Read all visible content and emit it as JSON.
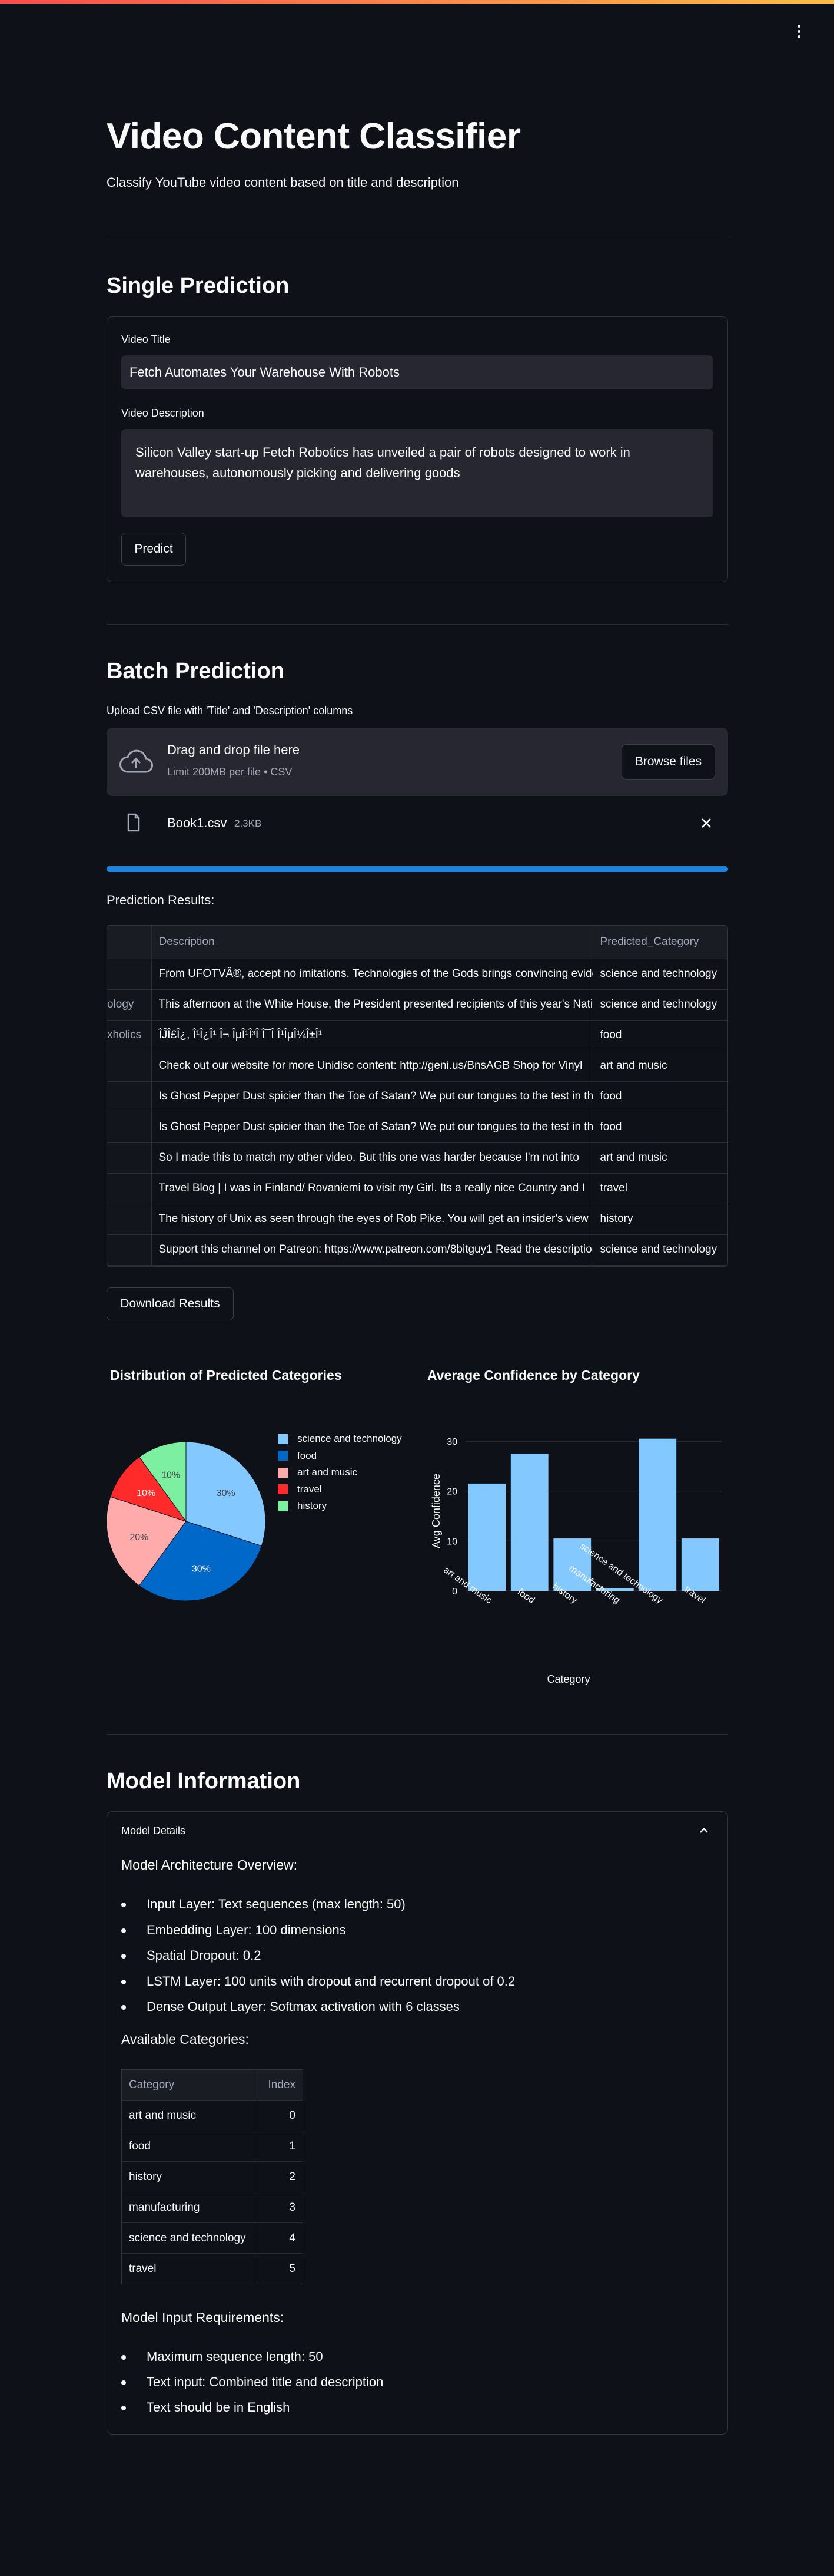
{
  "app": {
    "title": "Video Content Classifier",
    "subtitle": "Classify YouTube video content based on title and description"
  },
  "single": {
    "heading": "Single Prediction",
    "title_label": "Video Title",
    "title_value": "Fetch Automates Your Warehouse With Robots",
    "desc_label": "Video Description",
    "desc_value": "Silicon Valley start-up Fetch Robotics has unveiled a pair of robots designed to work in warehouses, autonomously picking and delivering goods",
    "predict_label": "Predict"
  },
  "batch": {
    "heading": "Batch Prediction",
    "upload_label": "Upload CSV file with 'Title' and 'Description' columns",
    "drop_title": "Drag and drop file here",
    "drop_limit": "Limit 200MB per file • CSV",
    "browse_label": "Browse files",
    "file_name": "Book1.csv",
    "file_size": "2.3KB",
    "progress": 1.0,
    "results_label": "Prediction Results:",
    "columns": [
      "Description",
      "Predicted_Category"
    ],
    "rows": [
      {
        "left": "",
        "description": "From UFOTVÂ®, accept no imitations. Technologies of the Gods brings convincing evidence",
        "category": "science and technology"
      },
      {
        "left": "ology",
        "description": "This afternoon at the White House, the President presented recipients of this year's National Medal",
        "category": "science and technology"
      },
      {
        "left": "xholics",
        "description": "ÎĴÎ£Î¿, Î¹Î¿Î¹ Î¬ ÎµÎ¹Î³Î Î¯Î Î¹ÎµÎ¼Î±Î¹",
        "category": "food"
      },
      {
        "left": "",
        "description": "Check out our website for more Unidisc content: http://geni.us/BnsAGB Shop for Vinyl",
        "category": "art and music"
      },
      {
        "left": "",
        "description": "Is Ghost Pepper Dust spicier than the Toe of Satan? We put our tongues to the test in this",
        "category": "food"
      },
      {
        "left": "",
        "description": "Is Ghost Pepper Dust spicier than the Toe of Satan? We put our tongues to the test in this",
        "category": "food"
      },
      {
        "left": "",
        "description": "So I made this to match my other video. But this one was harder because I'm not into",
        "category": "art and music"
      },
      {
        "left": "",
        "description": "Travel Blog | I was in Finland/ Rovaniemi to visit my Girl. Its a really nice Country and I",
        "category": "travel"
      },
      {
        "left": "",
        "description": "The history of Unix as seen through the eyes of Rob Pike. You will get an insider's view",
        "category": "history"
      },
      {
        "left": "",
        "description": "Support this channel on Patreon: https://www.patreon.com/8bitguy1 Read the description",
        "category": "science and technology"
      }
    ],
    "download_label": "Download Results"
  },
  "chart_data": [
    {
      "type": "pie",
      "title": "Distribution of Predicted Categories",
      "labels": [
        "science and technology",
        "food",
        "art and music",
        "travel",
        "history"
      ],
      "values": [
        30,
        30,
        20,
        10,
        10
      ],
      "slice_labels": [
        "30%",
        "30%",
        "20%",
        "10%",
        "10%"
      ],
      "colors": [
        "#83c9ff",
        "#0068c9",
        "#ffabab",
        "#ff2b2b",
        "#7defa1"
      ],
      "legend": "right"
    },
    {
      "type": "bar",
      "title": "Average Confidence by Category",
      "categories": [
        "art and music",
        "food",
        "history",
        "manufacturing",
        "science and technology",
        "travel"
      ],
      "values": [
        21.5,
        27.5,
        10.5,
        0.5,
        30.5,
        10.5
      ],
      "xlabel": "Category",
      "ylabel": "Avg Confidence",
      "ylim": [
        0,
        32
      ],
      "yticks": [
        0,
        10,
        20,
        30
      ],
      "color": "#83c9ff",
      "grid": true
    }
  ],
  "model": {
    "heading": "Model Information",
    "expander_label": "Model Details",
    "arch_heading": "Model Architecture Overview:",
    "arch_items": [
      "Input Layer: Text sequences (max length: 50)",
      "Embedding Layer: 100 dimensions",
      "Spatial Dropout: 0.2",
      "LSTM Layer: 100 units with dropout and recurrent dropout of 0.2",
      "Dense Output Layer: Softmax activation with 6 classes"
    ],
    "cats_heading": "Available Categories:",
    "cat_columns": [
      "Category",
      "Index"
    ],
    "categories": [
      {
        "name": "art and music",
        "index": "0"
      },
      {
        "name": "food",
        "index": "1"
      },
      {
        "name": "history",
        "index": "2"
      },
      {
        "name": "manufacturing",
        "index": "3"
      },
      {
        "name": "science and technology",
        "index": "4"
      },
      {
        "name": "travel",
        "index": "5"
      }
    ],
    "req_heading": "Model Input Requirements:",
    "req_items": [
      "Maximum sequence length: 50",
      "Text input: Combined title and description",
      "Text should be in English"
    ]
  }
}
